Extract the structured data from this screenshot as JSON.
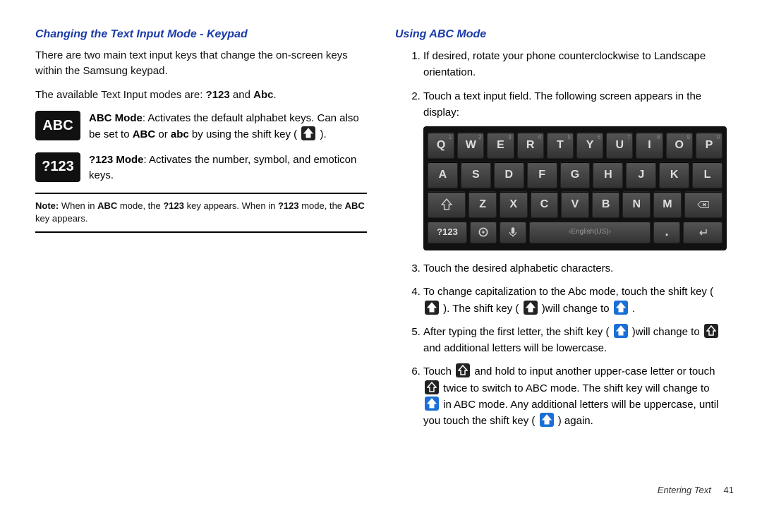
{
  "left": {
    "heading": "Changing the Text Input Mode - Keypad",
    "intro": "There are two main text input keys that change the on-screen keys within the Samsung keypad.",
    "available_pre": "The available Text Input modes are: ",
    "mode1_bold": "?123",
    "and": " and ",
    "mode2_bold": "Abc",
    "dot": ".",
    "abc_key_label": "ABC",
    "abc_desc_bold": "ABC Mode",
    "abc_desc_1": ": Activates the default alphabet keys. Can also be set to ",
    "abc_desc_b2": "ABC",
    "abc_desc_or": " or ",
    "abc_desc_b3": "abc",
    "abc_desc_2": " by using the shift key ( ",
    "abc_desc_3": " ).",
    "n123_key_label": "?123",
    "n123_desc_bold": "?123 Mode",
    "n123_desc": ": Activates the number, symbol, and emoticon keys.",
    "note_bold": "Note:",
    "note_1": " When in ",
    "note_b1": "ABC",
    "note_2": " mode, the ",
    "note_b2": "?123",
    "note_3": " key appears. When in ",
    "note_b3": "?123",
    "note_4": " mode, the ",
    "note_b4": "ABC",
    "note_5": " key appears."
  },
  "right": {
    "heading": "Using ABC Mode",
    "items": {
      "i1": "If desired, rotate your phone counterclockwise to Landscape orientation.",
      "i2": "Touch a text input field. The following screen appears in the display:",
      "i3": "Touch the desired alphabetic characters.",
      "i4_a": "To change capitalization to the Abc mode, touch the shift key ( ",
      "i4_b": " ). The shift key ( ",
      "i4_c": " )will change to ",
      "i4_d": " .",
      "i5_a": "After typing the first letter, the shift key ( ",
      "i5_b": " )will change to ",
      "i5_c": " and additional letters will be lowercase.",
      "i6_a": "Touch ",
      "i6_b": " and hold to input another upper-case letter or touch ",
      "i6_c": " twice to switch to ABC mode. The shift key will change to ",
      "i6_d": " in ABC mode. Any additional letters will be uppercase, until you touch the shift key ( ",
      "i6_e": " ) again."
    }
  },
  "keyboard": {
    "row1": [
      "Q",
      "W",
      "E",
      "R",
      "T",
      "Y",
      "U",
      "I",
      "O",
      "P"
    ],
    "sup1": [
      "1",
      "2",
      "3",
      "4",
      "5",
      "6",
      "7",
      "8",
      "9",
      "0"
    ],
    "row2": [
      "A",
      "S",
      "D",
      "F",
      "G",
      "H",
      "J",
      "K",
      "L"
    ],
    "row3": [
      "Z",
      "X",
      "C",
      "V",
      "B",
      "N",
      "M"
    ],
    "n123": "?123",
    "space": "English(US)"
  },
  "footer": {
    "chapter": "Entering Text",
    "page": "41"
  }
}
